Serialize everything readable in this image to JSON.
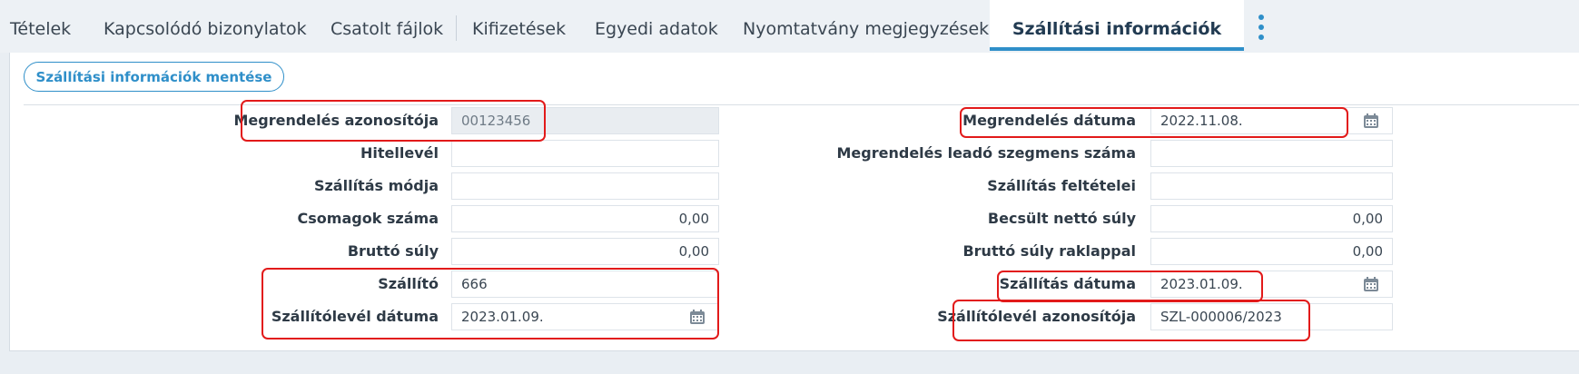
{
  "tabs": [
    {
      "label": "Tételek"
    },
    {
      "label": "Kapcsolódó bizonylatok"
    },
    {
      "label": "Csatolt fájlok"
    },
    {
      "label": "Kifizetések"
    },
    {
      "label": "Egyedi adatok"
    },
    {
      "label": "Nyomtatvány megjegyzések"
    },
    {
      "label": "Szállítási információk",
      "active": true
    }
  ],
  "save_button": "Szállítási információk mentése",
  "left_fields": [
    {
      "label": "Megrendelés azonosítója",
      "value": "00123456",
      "disabled": true
    },
    {
      "label": "Hitellevél",
      "value": ""
    },
    {
      "label": "Szállítás módja",
      "value": ""
    },
    {
      "label": "Csomagok száma",
      "value": "0,00"
    },
    {
      "label": "Bruttó súly",
      "value": "0,00"
    },
    {
      "label": "Szállító",
      "value": "666"
    },
    {
      "label": "Szállítólevél dátuma",
      "value": "2023.01.09.",
      "icon": "calendar-icon"
    }
  ],
  "right_fields": [
    {
      "label": "Megrendelés dátuma",
      "value": "2022.11.08.",
      "icon": "calendar-icon"
    },
    {
      "label": "Megrendelés leadó szegmens száma",
      "value": ""
    },
    {
      "label": "Szállítás feltételei",
      "value": ""
    },
    {
      "label": "Becsült nettó súly",
      "value": "0,00"
    },
    {
      "label": "Bruttó súly raklappal",
      "value": "0,00"
    },
    {
      "label": "Szállítás dátuma",
      "value": "2023.01.09.",
      "icon": "calendar-icon"
    },
    {
      "label": "Szállítólevél azonosítója",
      "value": "SZL-000006/2023"
    }
  ],
  "colors": {
    "accent": "#2f8fc9",
    "highlight": "#e21a1a",
    "background": "#e9eef3"
  }
}
